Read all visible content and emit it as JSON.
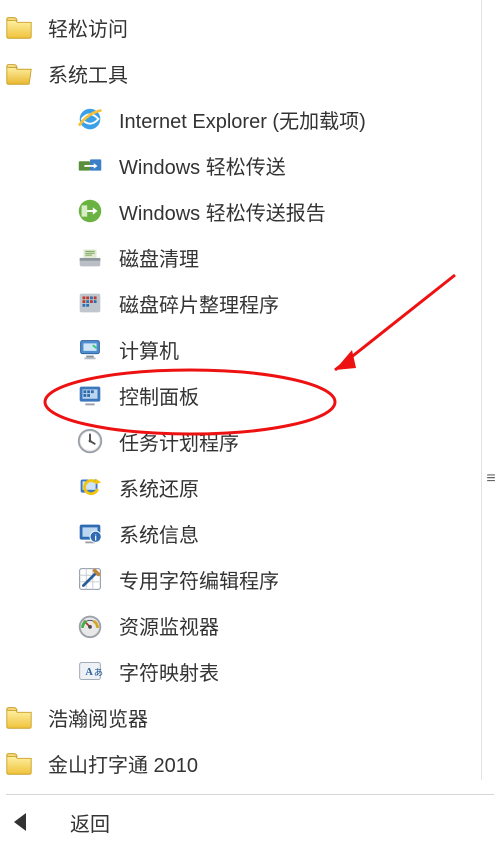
{
  "folders": {
    "easy_access": "轻松访问",
    "system_tools": "系统工具",
    "haohan_browser": "浩瀚阅览器",
    "jinshan_typing": "金山打字通 2010"
  },
  "apps": {
    "ie": "Internet Explorer (无加载项)",
    "easy_transfer": "Windows 轻松传送",
    "easy_transfer_report": "Windows 轻松传送报告",
    "disk_cleanup": "磁盘清理",
    "defrag": "磁盘碎片整理程序",
    "computer": "计算机",
    "control_panel": "控制面板",
    "task_scheduler": "任务计划程序",
    "system_restore": "系统还原",
    "system_info": "系统信息",
    "char_editor": "专用字符编辑程序",
    "resource_monitor": "资源监视器",
    "char_map": "字符映射表"
  },
  "back_label": "返回",
  "annotation": {
    "highlighted_item": "task_scheduler",
    "style": "red-ellipse-with-arrow"
  }
}
